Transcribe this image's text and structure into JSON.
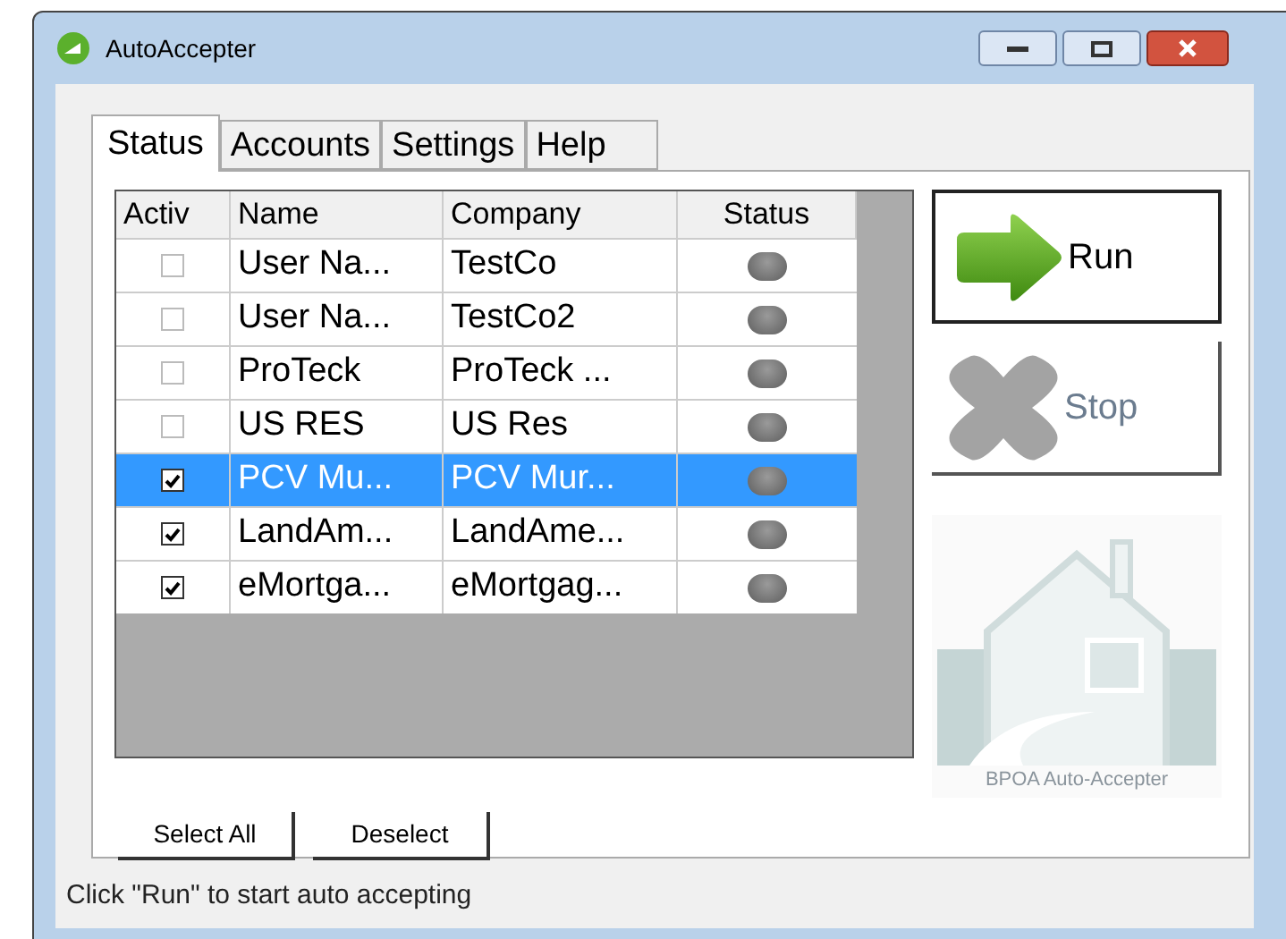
{
  "window": {
    "title": "AutoAccepter"
  },
  "tabs": [
    {
      "label": "Status",
      "selected": true
    },
    {
      "label": "Accounts",
      "selected": false
    },
    {
      "label": "Settings",
      "selected": false
    },
    {
      "label": "Help",
      "selected": false
    }
  ],
  "table": {
    "columns": [
      "Activ",
      "Name",
      "Company",
      "Status"
    ],
    "rows": [
      {
        "active": false,
        "name": "User Na...",
        "company": "TestCo",
        "selected": false
      },
      {
        "active": false,
        "name": "User Na...",
        "company": "TestCo2",
        "selected": false
      },
      {
        "active": false,
        "name": "ProTeck",
        "company": "ProTeck ...",
        "selected": false
      },
      {
        "active": false,
        "name": "US RES",
        "company": "US Res",
        "selected": false
      },
      {
        "active": true,
        "name": "PCV Mu...",
        "company": "PCV Mur...",
        "selected": true
      },
      {
        "active": true,
        "name": "LandAm...",
        "company": "LandAme...",
        "selected": false
      },
      {
        "active": true,
        "name": "eMortga...",
        "company": "eMortgag...",
        "selected": false
      }
    ]
  },
  "actions": [
    {
      "label": "Run",
      "kind": "run",
      "disabled": false
    },
    {
      "label": "Stop",
      "kind": "stop",
      "disabled": true
    }
  ],
  "logo": {
    "caption": "BPOA Auto-Accepter"
  },
  "selection_buttons": [
    "Select All",
    "Deselect"
  ],
  "status_bar": "Click \"Run\" to start auto accepting"
}
